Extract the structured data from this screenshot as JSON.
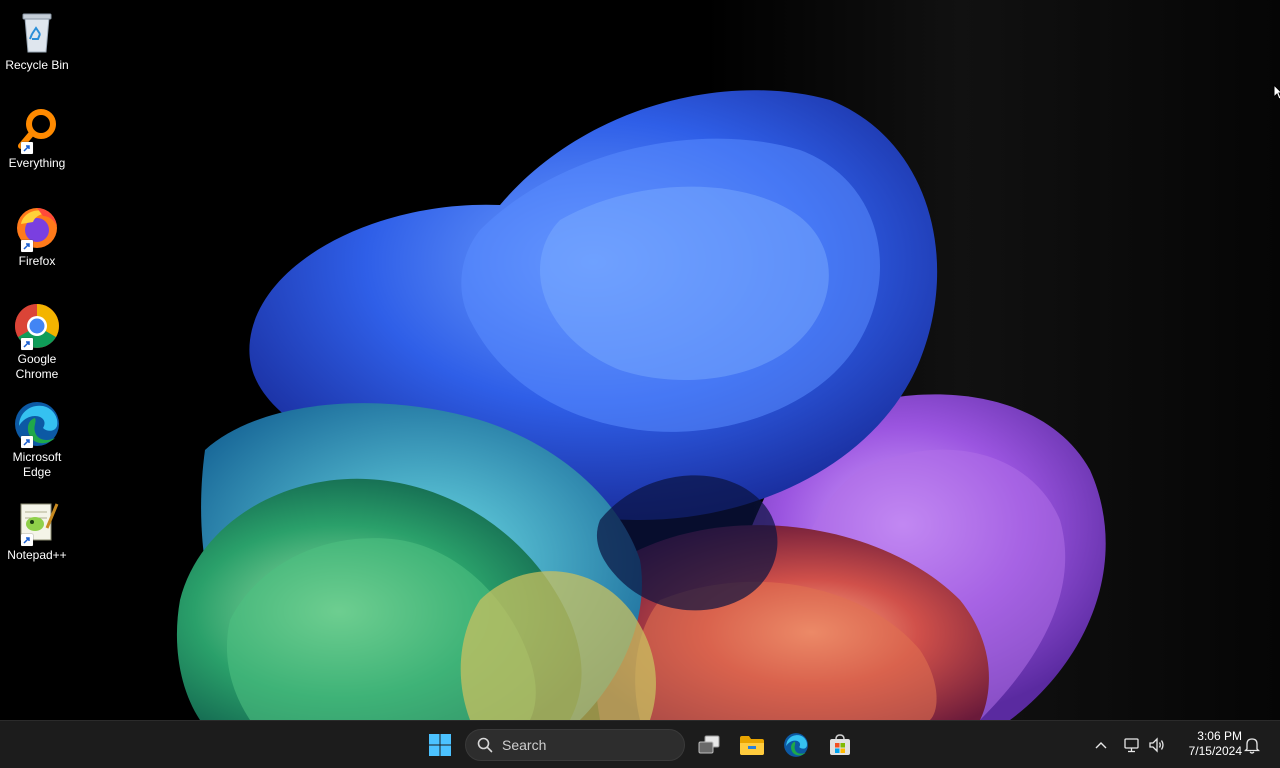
{
  "desktop": {
    "icons": [
      {
        "label": "Recycle Bin",
        "icon": "recycle-bin-icon"
      },
      {
        "label": "Everything",
        "icon": "everything-search-icon"
      },
      {
        "label": "Firefox",
        "icon": "firefox-icon"
      },
      {
        "label": "Google Chrome",
        "icon": "chrome-icon"
      },
      {
        "label": "Microsoft Edge",
        "icon": "edge-icon"
      },
      {
        "label": "Notepad++",
        "icon": "notepad-plus-plus-icon"
      }
    ]
  },
  "taskbar": {
    "search_placeholder": "Search",
    "pinned": [
      "start-button",
      "task-view-button",
      "file-explorer-button",
      "edge-button",
      "microsoft-store-button"
    ],
    "clock": {
      "time": "3:06 PM",
      "date": "7/15/2024"
    },
    "accent": "#0078d4"
  }
}
